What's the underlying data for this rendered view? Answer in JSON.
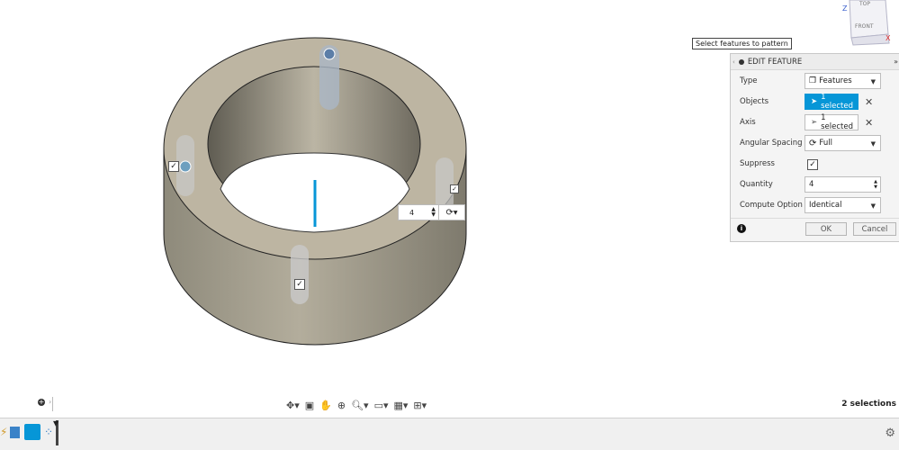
{
  "tooltip": "Select features to pattern",
  "viewcube": {
    "top": "TOP",
    "front": "FRONT",
    "axis_z": "Z",
    "axis_x": "X"
  },
  "panel": {
    "title": "EDIT FEATURE",
    "rows": {
      "type": {
        "label": "Type",
        "value": "Features"
      },
      "objects": {
        "label": "Objects",
        "value": "1 selected"
      },
      "axis": {
        "label": "Axis",
        "value": "1 selected"
      },
      "angular_spacing": {
        "label": "Angular Spacing",
        "value": "Full"
      },
      "suppress": {
        "label": "Suppress",
        "checked": true
      },
      "quantity": {
        "label": "Quantity",
        "value": "4"
      },
      "compute_option": {
        "label": "Compute Option",
        "value": "Identical"
      }
    },
    "ok_label": "OK",
    "cancel_label": "Cancel"
  },
  "canvas": {
    "quantity_value": "4"
  },
  "status": {
    "selections": "2 selections"
  },
  "colors": {
    "accent": "#0696d7",
    "ring_top": "#bdb5a2",
    "ring_side": "#9a9584"
  }
}
